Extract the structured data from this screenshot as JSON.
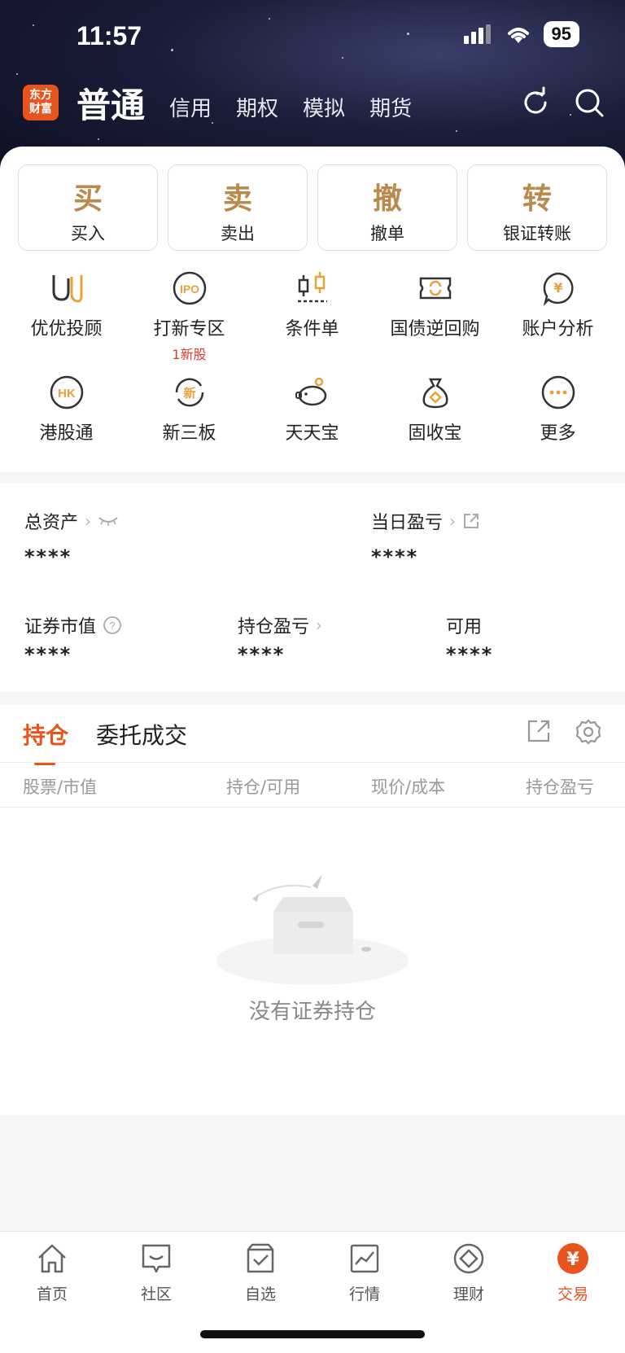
{
  "status_bar": {
    "time": "11:57",
    "battery": "95"
  },
  "header": {
    "logo_line1": "东方",
    "logo_line2": "财富",
    "tabs": [
      "普通",
      "信用",
      "期权",
      "模拟",
      "期货"
    ]
  },
  "quick_actions": [
    {
      "glyph": "买",
      "label": "买入"
    },
    {
      "glyph": "卖",
      "label": "卖出"
    },
    {
      "glyph": "撤",
      "label": "撤单"
    },
    {
      "glyph": "转",
      "label": "银证转账"
    }
  ],
  "features": [
    {
      "label": "优优投顾",
      "icon": "uu-icon"
    },
    {
      "label": "打新专区",
      "sub": "1新股",
      "icon": "ipo-icon"
    },
    {
      "label": "条件单",
      "icon": "condition-order-icon"
    },
    {
      "label": "国债逆回购",
      "icon": "repo-icon"
    },
    {
      "label": "账户分析",
      "icon": "analysis-icon"
    },
    {
      "label": "港股通",
      "icon": "hk-icon"
    },
    {
      "label": "新三板",
      "icon": "new-board-icon"
    },
    {
      "label": "天天宝",
      "icon": "piggy-bank-icon"
    },
    {
      "label": "固收宝",
      "icon": "money-bag-icon"
    },
    {
      "label": "更多",
      "icon": "more-icon"
    }
  ],
  "assets": {
    "total_label": "总资产",
    "total_value": "****",
    "daily_pl_label": "当日盈亏",
    "daily_pl_value": "****",
    "market_value_label": "证券市值",
    "market_value_value": "****",
    "position_pl_label": "持仓盈亏",
    "position_pl_value": "****",
    "available_label": "可用",
    "available_value": "****"
  },
  "positions": {
    "tab_active": "持仓",
    "tab_other": "委托成交",
    "columns": [
      "股票/市值",
      "持仓/可用",
      "现价/成本",
      "持仓盈亏"
    ],
    "empty_text": "没有证券持仓"
  },
  "bottom_nav": [
    {
      "label": "首页",
      "icon": "home-icon"
    },
    {
      "label": "社区",
      "icon": "community-icon"
    },
    {
      "label": "自选",
      "icon": "watchlist-icon"
    },
    {
      "label": "行情",
      "icon": "market-icon"
    },
    {
      "label": "理财",
      "icon": "wealth-icon"
    },
    {
      "label": "交易",
      "icon": "trade-icon",
      "active": true
    }
  ],
  "colors": {
    "accent": "#e8541e",
    "gold": "#b98a4c",
    "red": "#e03c31"
  }
}
